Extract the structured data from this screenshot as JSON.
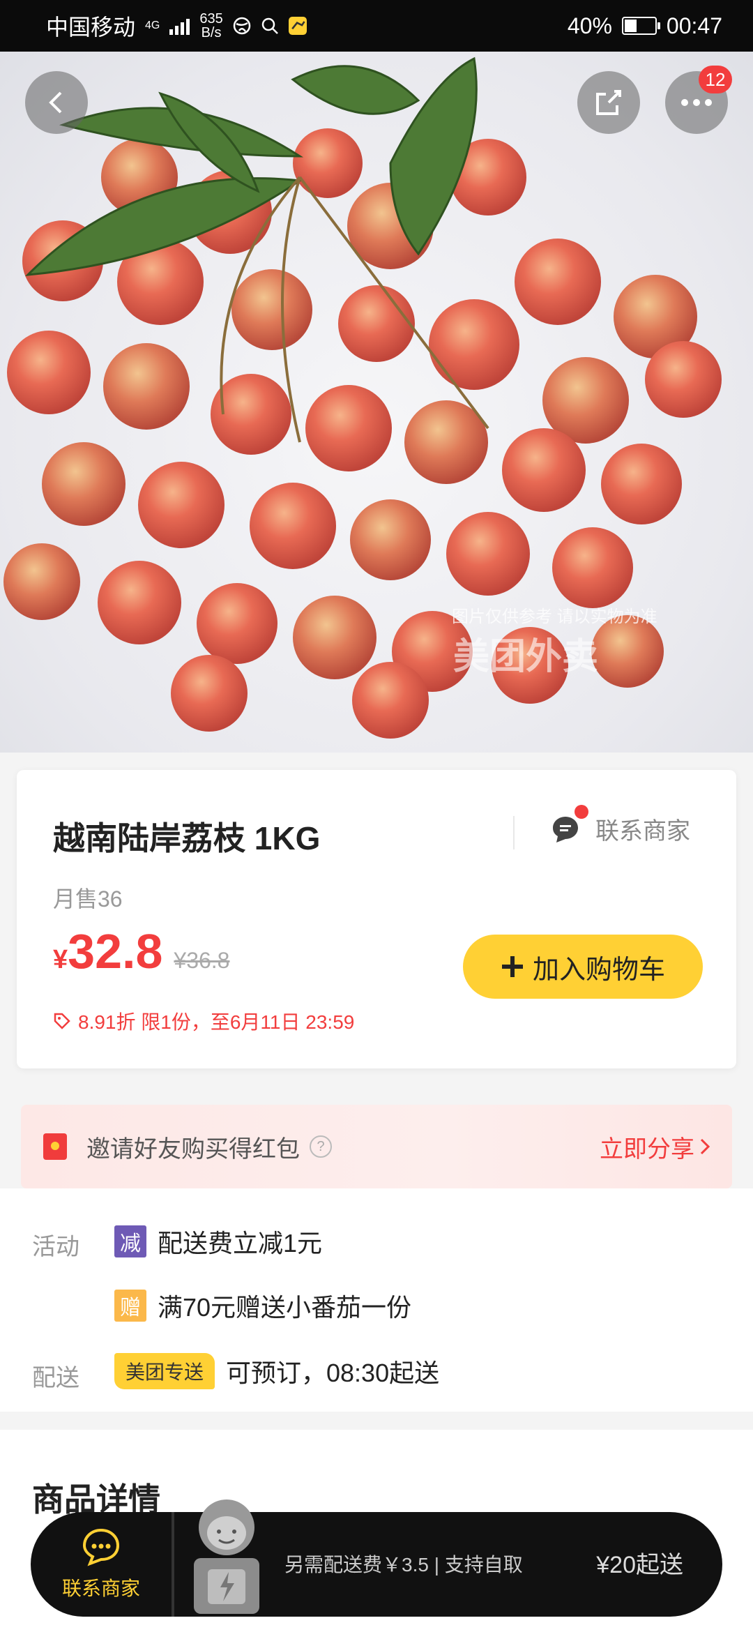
{
  "status_bar": {
    "carrier": "中国移动",
    "network": "4G",
    "net_speed_value": "635",
    "net_speed_unit": "B/s",
    "battery": "40%",
    "battery_level": 0.4,
    "time": "00:47"
  },
  "hero": {
    "watermark_text": "图片仅供参考 请以实物为准",
    "watermark_brand": "美团外卖",
    "more_badge": "12"
  },
  "product": {
    "title": "越南陆岸荔枝 1KG",
    "contact_label": "联系商家",
    "monthly_sales": "月售36",
    "currency": "¥",
    "price": "32.8",
    "original_price": "¥36.8",
    "add_to_cart": "加入购物车",
    "discount_info": "8.91折 限1份，至6月11日 23:59"
  },
  "invite": {
    "label": "邀请好友购买得红包",
    "help": "?",
    "share": "立即分享"
  },
  "activities": {
    "label": "活动",
    "items": [
      {
        "tag": "减",
        "text": "配送费立减1元"
      },
      {
        "tag": "赠",
        "text": "满70元赠送小番茄一份"
      }
    ]
  },
  "delivery": {
    "label": "配送",
    "tag": "美团专送",
    "text": "可预订，08:30起送"
  },
  "details": {
    "title": "商品详情"
  },
  "bottom_bar": {
    "contact": "联系商家",
    "fee_text": "另需配送费￥3.5 | 支持自取",
    "min_order": "¥20起送"
  },
  "colors": {
    "accent_red": "#f23d3d",
    "accent_yellow": "#ffd034",
    "reduce_tag": "#6e5ab5",
    "gift_tag": "#fbb84a"
  }
}
